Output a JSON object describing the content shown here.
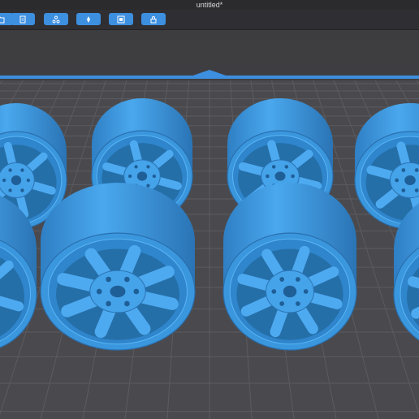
{
  "window": {
    "title": "untitled*"
  },
  "toolbar": {
    "buttons": [
      {
        "icon": "open-file-icon"
      },
      {
        "icon": "layers-icon"
      },
      {
        "icon": "tree-icon"
      },
      {
        "icon": "support-icon"
      },
      {
        "icon": "frame-icon"
      },
      {
        "icon": "lock-icon"
      }
    ]
  },
  "viewport": {
    "model_color": "#3f9ee6",
    "platform_color": "#4a4a4e",
    "grid_color": "#5b5b60",
    "frame_color": "#3d8fe0",
    "objects": [
      "wheel",
      "wheel",
      "wheel",
      "wheel",
      "wheel",
      "wheel",
      "wheel",
      "wheel"
    ]
  }
}
